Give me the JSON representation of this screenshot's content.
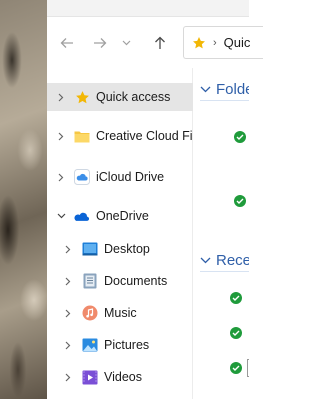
{
  "address_bar": {
    "crumbs": [
      "Quic"
    ],
    "star_color": "#f2b705"
  },
  "toolbar": {
    "back_icon": "arrow-left-icon",
    "forward_icon": "arrow-right-icon",
    "recent_dropdown_icon": "chevron-down-icon",
    "up_icon": "arrow-up-icon"
  },
  "nav_pane": {
    "items": [
      {
        "label": "Quick access",
        "icon": "star-icon",
        "selected": true
      },
      {
        "label": "Creative Cloud File",
        "icon": "folder-icon"
      },
      {
        "label": "iCloud Drive",
        "icon": "icloud-icon"
      },
      {
        "label": "OneDrive",
        "icon": "onedrive-icon",
        "expanded": true
      },
      {
        "label": "Desktop",
        "icon": "desktop-icon"
      },
      {
        "label": "Documents",
        "icon": "documents-icon"
      },
      {
        "label": "Music",
        "icon": "music-icon"
      },
      {
        "label": "Pictures",
        "icon": "pictures-icon"
      },
      {
        "label": "Videos",
        "icon": "videos-icon"
      }
    ]
  },
  "content": {
    "groups": [
      {
        "title": "Folde"
      },
      {
        "title": "Rece"
      }
    ]
  },
  "colors": {
    "accent": "#2f5fa8",
    "selected_bg": "#e5e5e5",
    "sync_ok": "#1f9b3b",
    "folder": "#f6c744",
    "onedrive": "#0a64d6"
  }
}
